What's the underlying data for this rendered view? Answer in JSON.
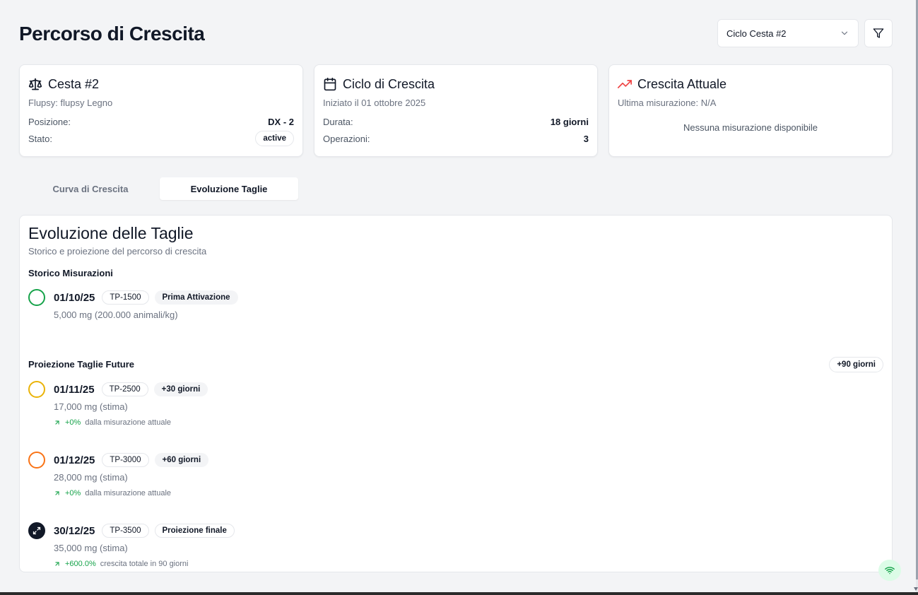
{
  "page": {
    "title": "Percorso di Crescita"
  },
  "header": {
    "cycle_select_value": "Ciclo Cesta #2"
  },
  "cards": {
    "basket": {
      "title": "Cesta #2",
      "subtitle": "Flupsy: flupsy Legno",
      "position_label": "Posizione:",
      "position_value": "DX - 2",
      "status_label": "Stato:",
      "status_value": "active"
    },
    "cycle": {
      "title": "Ciclo di Crescita",
      "subtitle": "Iniziato il 01 ottobre 2025",
      "duration_label": "Durata:",
      "duration_value": "18 giorni",
      "operations_label": "Operazioni:",
      "operations_value": "3"
    },
    "growth": {
      "title": "Crescita Attuale",
      "subtitle": "Ultima misurazione: N/A",
      "empty_message": "Nessuna misurazione disponibile",
      "accent": "#ef4444"
    }
  },
  "tabs": [
    {
      "label": "Curva di Crescita",
      "active": false
    },
    {
      "label": "Evoluzione Taglie",
      "active": true
    }
  ],
  "evolution": {
    "title": "Evoluzione delle Taglie",
    "subtitle": "Storico e proiezione del percorso di crescita",
    "history_title": "Storico Misurazioni",
    "history": [
      {
        "date": "01/10/25",
        "size": "TP-1500",
        "label": "Prima Attivazione",
        "weight": "5,000 mg (200.000 animali/kg)",
        "color": "#16a34a"
      }
    ],
    "projection_title": "Proiezione Taglie Future",
    "horizon": "+90 giorni",
    "projections": [
      {
        "date": "01/11/25",
        "size": "TP-2500",
        "label": "+30 giorni",
        "weight": "17,000 mg (stima)",
        "growth_pct": "+0%",
        "growth_text": "dalla misurazione attuale",
        "color": "#eab308"
      },
      {
        "date": "01/12/25",
        "size": "TP-3000",
        "label": "+60 giorni",
        "weight": "28,000 mg (stima)",
        "growth_pct": "+0%",
        "growth_text": "dalla misurazione attuale",
        "color": "#f97316"
      },
      {
        "date": "30/12/25",
        "size": "TP-3500",
        "label": "Proiezione finale",
        "weight": "35,000 mg (stima)",
        "growth_pct": "+600.0%",
        "growth_text": "crescita totale in 90 giorni",
        "color": "#111827"
      }
    ]
  },
  "icons": {
    "basket": "scale-icon",
    "cycle": "calendar-icon",
    "growth": "trending-up-icon",
    "filter": "filter-icon",
    "status": "wifi-icon"
  }
}
